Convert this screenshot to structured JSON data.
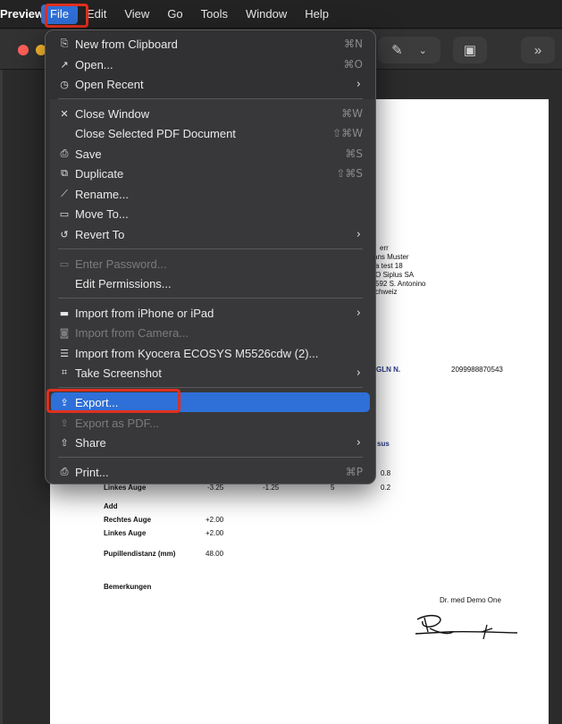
{
  "menubar": {
    "app": "Preview",
    "items": [
      "File",
      "Edit",
      "View",
      "Go",
      "Tools",
      "Window",
      "Help"
    ]
  },
  "file_menu": {
    "items": [
      {
        "label": "New from Clipboard",
        "shortcut": "⌘N",
        "icon": "clipboard-icon"
      },
      {
        "label": "Open...",
        "shortcut": "⌘O",
        "icon": "arrow-up-right-icon"
      },
      {
        "label": "Open Recent",
        "submenu": "›",
        "icon": "clock-icon"
      },
      {
        "label": "Close Window",
        "shortcut": "⌘W",
        "icon": "x-icon"
      },
      {
        "label": "Close Selected PDF Document",
        "shortcut": "⇧⌘W"
      },
      {
        "label": "Save",
        "shortcut": "⌘S",
        "icon": "save-icon"
      },
      {
        "label": "Duplicate",
        "shortcut": "⇧⌘S",
        "icon": "duplicate-icon"
      },
      {
        "label": "Rename...",
        "icon": "pencil-icon"
      },
      {
        "label": "Move To...",
        "icon": "folder-icon"
      },
      {
        "label": "Revert To",
        "submenu": "›",
        "icon": "revert-icon"
      },
      {
        "label": "Enter Password...",
        "icon": "password-icon",
        "disabled": true
      },
      {
        "label": "Edit Permissions..."
      },
      {
        "label": "Import from iPhone or iPad",
        "submenu": "›",
        "icon": "device-icon"
      },
      {
        "label": "Import from Camera...",
        "icon": "camera-icon",
        "disabled": true
      },
      {
        "label": "Import from Kyocera ECOSYS M5526cdw (2)...",
        "icon": "scanner-icon"
      },
      {
        "label": "Take Screenshot",
        "submenu": "›",
        "icon": "screenshot-icon"
      },
      {
        "label": "Export...",
        "icon": "export-icon",
        "highlighted": true
      },
      {
        "label": "Export as PDF...",
        "icon": "pdf-icon",
        "disabled": true
      },
      {
        "label": "Share",
        "submenu": "›",
        "icon": "share-icon"
      },
      {
        "label": "Print...",
        "shortcut": "⌘P",
        "icon": "printer-icon"
      }
    ]
  },
  "document": {
    "address": [
      "err",
      "ans Muster",
      "a test 18",
      "O Siplus SA",
      "592 S. Antonino",
      "chweiz"
    ],
    "gln_label": "GLN N.",
    "gln_value": "2099988870543",
    "visus": "sus",
    "rows": [
      {
        "label": "Linkes Auge",
        "v1": "-3.25",
        "v2": "-1.25",
        "v3": "5",
        "v4": "0.2"
      }
    ],
    "r08": "0.8",
    "add": "Add",
    "add_rows": [
      {
        "label": "Rechtes Auge",
        "value": "+2.00"
      },
      {
        "label": "Linkes Auge",
        "value": "+2.00"
      }
    ],
    "pd_label": "Pupillendistanz (mm)",
    "pd_value": "48.00",
    "remarks": "Bemerkungen",
    "doctor": "Dr. med Demo One"
  }
}
